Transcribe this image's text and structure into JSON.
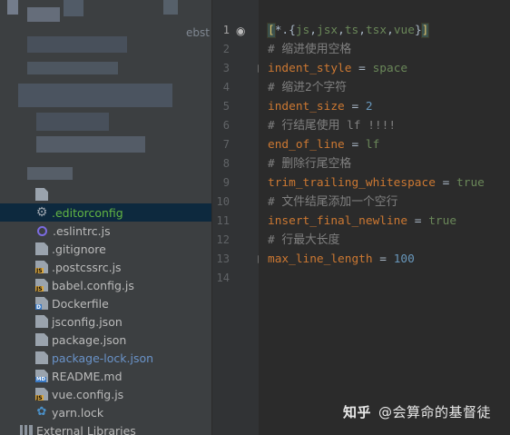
{
  "project_tree": {
    "tab_fragment": "ebst",
    "items": [
      {
        "label": "",
        "icon": "file-icon",
        "style": ""
      },
      {
        "label": ".editorconfig",
        "icon": "gear-icon",
        "style": "green",
        "selected": true
      },
      {
        "label": ".eslintrc.js",
        "icon": "eslint-icon",
        "style": ""
      },
      {
        "label": ".gitignore",
        "icon": "file-icon",
        "style": ""
      },
      {
        "label": ".postcssrc.js",
        "icon": "js-file-icon",
        "style": ""
      },
      {
        "label": "babel.config.js",
        "icon": "js-file-icon",
        "style": ""
      },
      {
        "label": "Dockerfile",
        "icon": "docker-file-icon",
        "style": ""
      },
      {
        "label": "jsconfig.json",
        "icon": "json-file-icon",
        "style": ""
      },
      {
        "label": "package.json",
        "icon": "json-file-icon",
        "style": ""
      },
      {
        "label": "package-lock.json",
        "icon": "json-file-icon",
        "style": "blue"
      },
      {
        "label": "README.md",
        "icon": "markdown-file-icon",
        "style": ""
      },
      {
        "label": "vue.config.js",
        "icon": "js-file-icon",
        "style": ""
      },
      {
        "label": "yarn.lock",
        "icon": "yarn-icon",
        "style": ""
      }
    ],
    "external_libraries": "External Libraries"
  },
  "editor": {
    "line_numbers": [
      "1",
      "2",
      "3",
      "4",
      "5",
      "6",
      "7",
      "8",
      "9",
      "10",
      "11",
      "12",
      "13",
      "14"
    ],
    "lines": [
      {
        "segments": [
          [
            "bracket",
            "["
          ],
          [
            "plain",
            "*.{"
          ],
          [
            "val",
            "js"
          ],
          [
            "plain",
            ","
          ],
          [
            "val",
            "jsx"
          ],
          [
            "plain",
            ","
          ],
          [
            "val",
            "ts"
          ],
          [
            "plain",
            ","
          ],
          [
            "val",
            "tsx"
          ],
          [
            "plain",
            ","
          ],
          [
            "val",
            "vue"
          ],
          [
            "plain",
            "}"
          ],
          [
            "bracket",
            "]"
          ]
        ]
      },
      {
        "segments": [
          [
            "comment",
            "# 缩进使用空格"
          ]
        ]
      },
      {
        "segments": [
          [
            "key",
            "indent_style"
          ],
          [
            "plain",
            " = "
          ],
          [
            "val",
            "space"
          ]
        ]
      },
      {
        "segments": [
          [
            "comment",
            "# 缩进2个字符"
          ]
        ]
      },
      {
        "segments": [
          [
            "key",
            "indent_size"
          ],
          [
            "plain",
            " = "
          ],
          [
            "num",
            "2"
          ]
        ]
      },
      {
        "segments": [
          [
            "comment",
            "# 行结尾使用 lf !!!!"
          ]
        ]
      },
      {
        "segments": [
          [
            "key",
            "end_of_line"
          ],
          [
            "plain",
            " = "
          ],
          [
            "val",
            "lf"
          ]
        ]
      },
      {
        "segments": [
          [
            "comment",
            "# 删除行尾空格"
          ]
        ]
      },
      {
        "segments": [
          [
            "key",
            "trim_trailing_whitespace"
          ],
          [
            "plain",
            " = "
          ],
          [
            "val",
            "true"
          ]
        ]
      },
      {
        "segments": [
          [
            "comment",
            "# 文件结尾添加一个空行"
          ]
        ]
      },
      {
        "segments": [
          [
            "key",
            "insert_final_newline"
          ],
          [
            "plain",
            " = "
          ],
          [
            "val",
            "true"
          ]
        ]
      },
      {
        "segments": [
          [
            "comment",
            "# 行最大长度"
          ]
        ]
      },
      {
        "segments": [
          [
            "key",
            "max_line_length"
          ],
          [
            "plain",
            " = "
          ],
          [
            "num",
            "100"
          ]
        ]
      },
      {
        "segments": []
      }
    ]
  },
  "watermark": {
    "logo": "知乎",
    "handle": "@会算命的基督徒"
  },
  "colors": {
    "comment": "#808080",
    "key": "#cc7832",
    "value": "#6a8759",
    "number": "#6897bb",
    "selected_row": "#0d293e"
  }
}
